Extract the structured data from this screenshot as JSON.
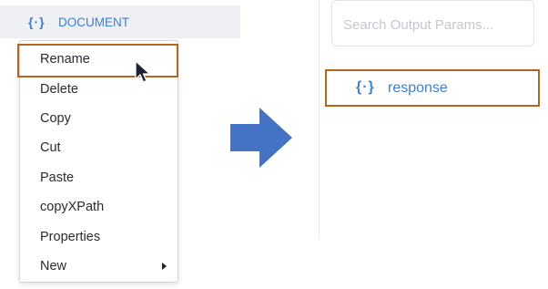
{
  "tree": {
    "icon": "{·}",
    "label": "DOCUMENT"
  },
  "context_menu": {
    "items": [
      {
        "label": "Rename",
        "highlighted": true
      },
      {
        "label": "Delete"
      },
      {
        "label": "Copy"
      },
      {
        "label": "Cut"
      },
      {
        "label": "Paste"
      },
      {
        "label": "copyXPath"
      },
      {
        "label": "Properties"
      },
      {
        "label": "New",
        "has_submenu": true
      }
    ]
  },
  "output_panel": {
    "search_placeholder": "Search Output Params...",
    "node": {
      "icon": "{·}",
      "label": "response"
    }
  },
  "colors": {
    "accent_blue": "#3d7fd9",
    "highlight_border": "#b5651d",
    "arrow": "#4472c4"
  }
}
